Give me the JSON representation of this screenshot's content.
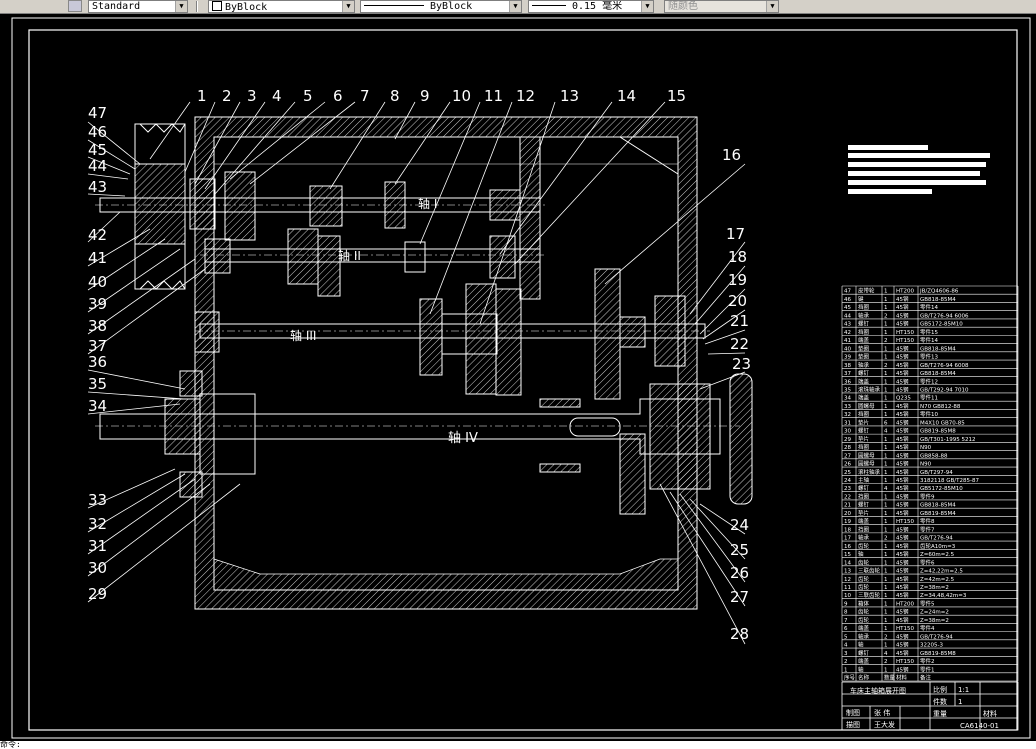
{
  "toolbar": {
    "text_style": "Standard",
    "layer_color": "ByBlock",
    "linetype": "ByBlock",
    "lineweight": "0.15 毫米",
    "plot_style": "随颜色"
  },
  "drawing": {
    "shaft_labels": [
      "轴 I",
      "轴 II",
      "轴 III",
      "轴 IV"
    ],
    "balloons_top": [
      "1",
      "2",
      "3",
      "4",
      "5",
      "6",
      "7",
      "8",
      "9",
      "10",
      "11",
      "12",
      "13",
      "14",
      "15"
    ],
    "balloons_right": [
      "16",
      "17",
      "18",
      "19",
      "20",
      "21",
      "22",
      "23",
      "24",
      "25",
      "26",
      "27",
      "28"
    ],
    "balloons_left": [
      "47",
      "46",
      "45",
      "44",
      "43",
      "42",
      "41",
      "40",
      "39",
      "38",
      "37",
      "36",
      "35",
      "34",
      "33",
      "32",
      "31",
      "30",
      "29"
    ]
  },
  "parts_list": {
    "rows": [
      [
        "47",
        "皮带轮",
        "1",
        "HT200",
        "JB/ZQ4606-86"
      ],
      [
        "46",
        "键",
        "1",
        "45钢",
        "GB818-85M4"
      ],
      [
        "45",
        "挡圈",
        "1",
        "45钢",
        "零件14"
      ],
      [
        "44",
        "轴承",
        "2",
        "45钢",
        "GB/T276-94 6006"
      ],
      [
        "43",
        "螺钉",
        "1",
        "45钢",
        "GB5172-85M10"
      ],
      [
        "42",
        "挡圈",
        "1",
        "HT150",
        "零件15"
      ],
      [
        "41",
        "端盖",
        "2",
        "HT150",
        "零件14"
      ],
      [
        "40",
        "垫圈",
        "1",
        "45钢",
        "GB818-85M4"
      ],
      [
        "39",
        "垫圈",
        "1",
        "45钢",
        "零件13"
      ],
      [
        "38",
        "轴承",
        "2",
        "45钢",
        "GB/T276-94 6008"
      ],
      [
        "37",
        "螺钉",
        "1",
        "45钢",
        "GB818-85M4"
      ],
      [
        "36",
        "端盖",
        "1",
        "45钢",
        "零件12"
      ],
      [
        "35",
        "滚珠轴承",
        "1",
        "45钢",
        "GB/T292-94 7010"
      ],
      [
        "34",
        "端盖",
        "1",
        "Q235",
        "零件11"
      ],
      [
        "33",
        "圆螺母",
        "1",
        "45钢",
        "N70 GB812-88"
      ],
      [
        "32",
        "挡圈",
        "1",
        "45钢",
        "零件10"
      ],
      [
        "31",
        "垫片",
        "6",
        "45钢",
        "M4X10 GB70-85"
      ],
      [
        "30",
        "螺钉",
        "4",
        "45钢",
        "GB819-85M8"
      ],
      [
        "29",
        "垫片",
        "1",
        "45钢",
        "GB/T301-1995 5212"
      ],
      [
        "28",
        "挡圈",
        "1",
        "45钢",
        "N90"
      ],
      [
        "27",
        "圆螺母",
        "1",
        "45钢",
        "GB858-88"
      ],
      [
        "26",
        "圆螺母",
        "1",
        "45钢",
        "N90"
      ],
      [
        "25",
        "滚柱轴承",
        "1",
        "45钢",
        "GB/T297-94"
      ],
      [
        "24",
        "主轴",
        "1",
        "45钢",
        "3182118 GB/T285-87"
      ],
      [
        "23",
        "螺钉",
        "4",
        "45钢",
        "GB5172-85M10"
      ],
      [
        "22",
        "挡圈",
        "1",
        "45钢",
        "零件9"
      ],
      [
        "21",
        "螺钉",
        "1",
        "45钢",
        "GB818-85M4"
      ],
      [
        "20",
        "垫片",
        "1",
        "45钢",
        "GB819-85M4"
      ],
      [
        "19",
        "端盖",
        "1",
        "HT150",
        "零件8"
      ],
      [
        "18",
        "挡圈",
        "1",
        "45钢",
        "零件7"
      ],
      [
        "17",
        "轴承",
        "2",
        "45钢",
        "GB/T276-94"
      ],
      [
        "16",
        "齿轮",
        "1",
        "45钢",
        "齿轮A10m=3"
      ],
      [
        "15",
        "轴",
        "1",
        "45钢",
        "Z=60m=2.5"
      ],
      [
        "14",
        "齿轮",
        "1",
        "45钢",
        "零件6"
      ],
      [
        "13",
        "三联齿轮",
        "1",
        "45钢",
        "Z=42,22m=2.5"
      ],
      [
        "12",
        "齿轮",
        "1",
        "45钢",
        "Z=42m=2.5"
      ],
      [
        "11",
        "齿轮",
        "1",
        "45钢",
        "Z=38m=2"
      ],
      [
        "10",
        "三联齿轮",
        "1",
        "45钢",
        "Z=34,48,42m=3"
      ],
      [
        "9",
        "箱体",
        "1",
        "HT200",
        "零件5"
      ],
      [
        "8",
        "齿轮",
        "1",
        "45钢",
        "Z=24m=2"
      ],
      [
        "7",
        "齿轮",
        "1",
        "45钢",
        "Z=38m=2"
      ],
      [
        "6",
        "端盖",
        "1",
        "HT150",
        "零件4"
      ],
      [
        "5",
        "轴承",
        "2",
        "45钢",
        "GB/T276-94"
      ],
      [
        "4",
        "轴",
        "1",
        "45钢",
        "32205-3"
      ],
      [
        "3",
        "螺钉",
        "4",
        "45钢",
        "GB819-85M8"
      ],
      [
        "2",
        "端盖",
        "2",
        "HT150",
        "零件2"
      ],
      [
        "1",
        "轴",
        "1",
        "45钢",
        "零件1"
      ]
    ],
    "header": [
      "序号",
      "名称",
      "数量",
      "材料",
      "备注"
    ]
  },
  "title_block": {
    "drawing_name": "车床主轴箱展开图",
    "scale_label": "比例",
    "scale_value": "1:1",
    "sheet_label": "件数",
    "sheet_value": "1",
    "designer_label": "制图",
    "designer_name": "张 伟",
    "checker_label": "描图",
    "checker_name": "王大发",
    "reviewer_label": "审核",
    "weight_label": "重量",
    "material_label": "材料",
    "drawing_no": "CA6140-01"
  },
  "cmdline": {
    "text": "命令:"
  }
}
